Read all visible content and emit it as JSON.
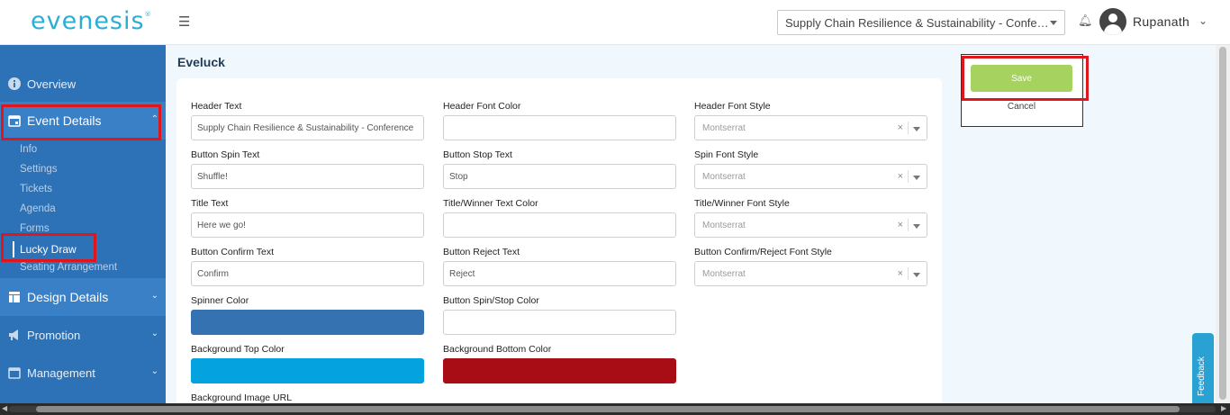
{
  "header": {
    "logo": "evenesis",
    "logo_mark": "®",
    "menu_icon": "☰",
    "event_selector_value": "Supply Chain Resilience & Sustainability - Confe…",
    "bell_icon": "🔔",
    "username": "Rupanath",
    "user_caret": "⌄"
  },
  "sidebar": {
    "overview": "Overview",
    "event_details": "Event Details",
    "event_sub_items": [
      "Info",
      "Settings",
      "Tickets",
      "Agenda",
      "Forms",
      "Lucky Draw",
      "Seating Arrangement"
    ],
    "active_sub_item": "Lucky Draw",
    "design_details": "Design Details",
    "promotion": "Promotion",
    "management": "Management"
  },
  "page": {
    "title": "Eveluck"
  },
  "form": {
    "header_text": {
      "label": "Header Text",
      "value": "Supply Chain Resilience & Sustainability - Conference"
    },
    "header_font_color": {
      "label": "Header Font Color",
      "value": ""
    },
    "header_font_style": {
      "label": "Header Font Style",
      "value": "Montserrat"
    },
    "button_spin_text": {
      "label": "Button Spin Text",
      "value": "Shuffle!"
    },
    "button_stop_text": {
      "label": "Button Stop Text",
      "value": "Stop"
    },
    "spin_font_style": {
      "label": "Spin Font Style",
      "value": "Montserrat"
    },
    "title_text": {
      "label": "Title Text",
      "value": "Here we go!"
    },
    "title_winner_text_color": {
      "label": "Title/Winner Text Color",
      "value": ""
    },
    "title_winner_font_style": {
      "label": "Title/Winner Font Style",
      "value": "Montserrat"
    },
    "button_confirm_text": {
      "label": "Button Confirm Text",
      "value": "Confirm"
    },
    "button_reject_text": {
      "label": "Button Reject Text",
      "value": "Reject"
    },
    "button_confirm_reject_font_style": {
      "label": "Button Confirm/Reject Font Style",
      "value": "Montserrat"
    },
    "spinner_color": {
      "label": "Spinner Color",
      "color": "#3572b2"
    },
    "button_spin_stop_color": {
      "label": "Button Spin/Stop Color",
      "color": "#ffffff"
    },
    "background_top_color": {
      "label": "Background Top Color",
      "color": "#04a3e0"
    },
    "background_bottom_color": {
      "label": "Background Bottom Color",
      "color": "#a80c14"
    },
    "background_image_url": {
      "label": "Background Image URL"
    },
    "clear_glyph": "×"
  },
  "actions": {
    "save": "Save",
    "cancel": "Cancel"
  },
  "feedback": {
    "label": "Feedback"
  },
  "colors": {
    "sidebar_bg": "#2d72b6",
    "accent": "#2aaed4",
    "save_green": "#a6d25f",
    "annotation_red": "#e0161d"
  }
}
